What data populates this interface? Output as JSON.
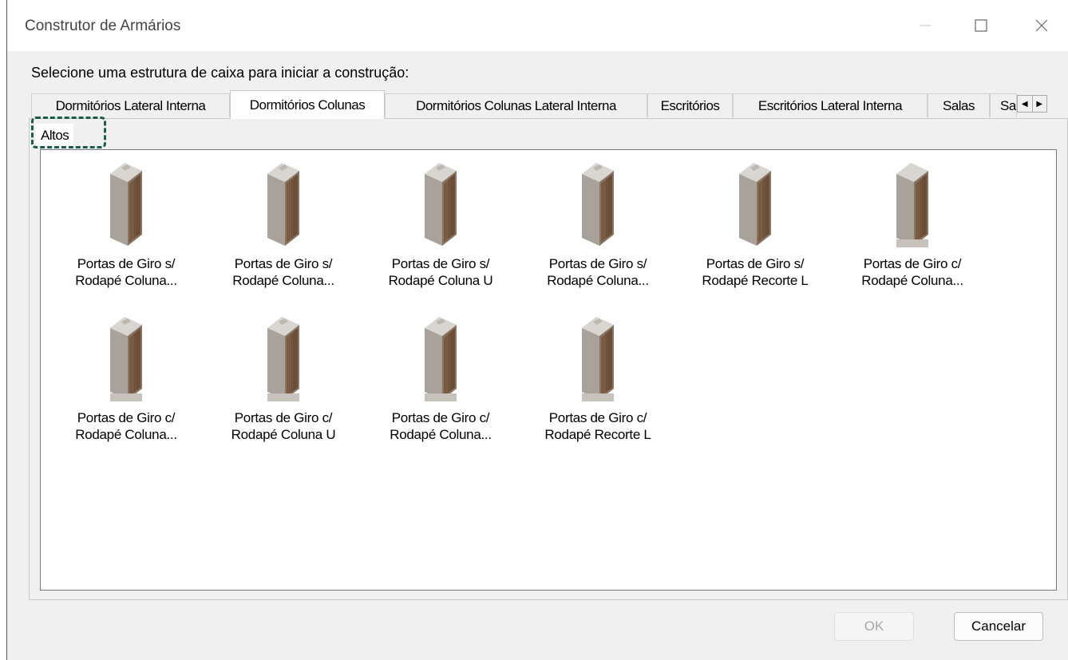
{
  "window": {
    "title": "Construtor de Armários",
    "minimize_icon": "minimize-icon",
    "maximize_icon": "maximize-icon",
    "close_icon": "close-icon"
  },
  "prompt": "Selecione uma estrutura de caixa para iniciar a construção:",
  "tabs": [
    {
      "label": "Dormitórios Lateral Interna",
      "active": false
    },
    {
      "label": "Dormitórios Colunas",
      "active": true
    },
    {
      "label": "Dormitórios Colunas Lateral Interna",
      "active": false
    },
    {
      "label": "Escritórios",
      "active": false
    },
    {
      "label": "Escritórios Lateral Interna",
      "active": false
    },
    {
      "label": "Salas",
      "active": false
    },
    {
      "label": "Sa",
      "active": false
    }
  ],
  "tab_scroll": {
    "left": "◀",
    "right": "▶"
  },
  "subtab": {
    "label": "Altos"
  },
  "items": [
    {
      "line1": "Portas de Giro s/",
      "line2": "Rodapé Coluna..."
    },
    {
      "line1": "Portas de Giro s/",
      "line2": "Rodapé Coluna..."
    },
    {
      "line1": "Portas de Giro s/",
      "line2": "Rodapé Coluna U"
    },
    {
      "line1": "Portas de Giro s/",
      "line2": "Rodapé Coluna..."
    },
    {
      "line1": "Portas de Giro s/",
      "line2": "Rodapé Recorte L"
    },
    {
      "line1": "Portas de Giro c/",
      "line2": "Rodapé Coluna..."
    },
    {
      "line1": "Portas de Giro c/",
      "line2": "Rodapé Coluna..."
    },
    {
      "line1": "Portas de Giro c/",
      "line2": "Rodapé Coluna U"
    },
    {
      "line1": "Portas de Giro c/",
      "line2": "Rodapé Coluna..."
    },
    {
      "line1": "Portas de Giro c/",
      "line2": "Rodapé Recorte L"
    }
  ],
  "buttons": {
    "ok": "OK",
    "cancel": "Cancelar"
  },
  "colors": {
    "wood": "#7a5a40",
    "frame": "#a8a29b",
    "highlight": "#1a5c4a"
  }
}
